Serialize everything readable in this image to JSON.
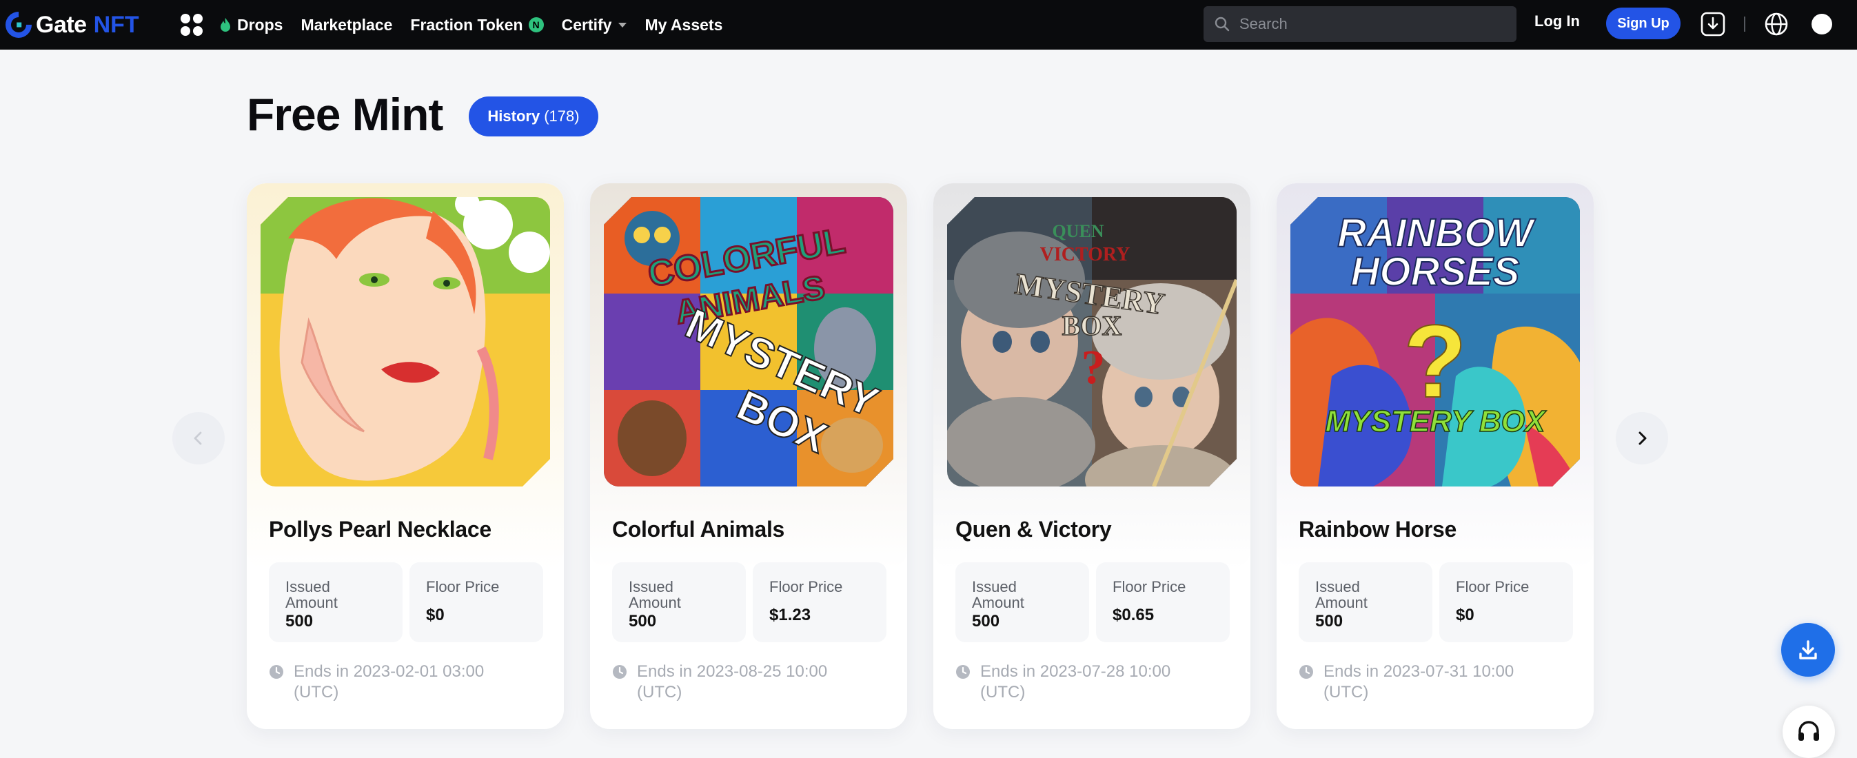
{
  "brand": {
    "name": "Gate",
    "suffix": "NFT"
  },
  "nav": {
    "items": [
      {
        "label": "Drops",
        "icon": "flame-icon"
      },
      {
        "label": "Marketplace"
      },
      {
        "label": "Fraction Token",
        "badge": "N"
      },
      {
        "label": "Certify",
        "dropdown": true
      },
      {
        "label": "My Assets"
      }
    ]
  },
  "search": {
    "placeholder": "Search"
  },
  "auth": {
    "login_label": "Log In",
    "signup_label": "Sign Up"
  },
  "page": {
    "title": "Free Mint",
    "history_label": "History",
    "history_count": "(178)"
  },
  "cards": [
    {
      "title": "Pollys Pearl Necklace",
      "issued_label": "Issued Amount",
      "issued_value": "500",
      "floor_label": "Floor Price",
      "floor_value": "$0",
      "ends_text": "Ends in 2023-02-01 03:00 (UTC)"
    },
    {
      "title": "Colorful Animals",
      "issued_label": "Issued Amount",
      "issued_value": "500",
      "floor_label": "Floor Price",
      "floor_value": "$1.23",
      "ends_text": "Ends in 2023-08-25 10:00 (UTC)",
      "image_text": [
        "COLORFUL",
        "ANIMALS",
        "MYSTERY",
        "BOX"
      ]
    },
    {
      "title": "Quen & Victory",
      "issued_label": "Issued Amount",
      "issued_value": "500",
      "floor_label": "Floor Price",
      "floor_value": "$0.65",
      "ends_text": "Ends in 2023-07-28 10:00 (UTC)",
      "image_text": [
        "QUEN",
        "VICTORY",
        "MYSTERY",
        "BOX"
      ]
    },
    {
      "title": "Rainbow Horse",
      "issued_label": "Issued Amount",
      "issued_value": "500",
      "floor_label": "Floor Price",
      "floor_value": "$0",
      "ends_text": "Ends in 2023-07-31 10:00 (UTC)",
      "image_text": [
        "RAINBOW",
        "HORSES",
        "?",
        "MYSTERY BOX"
      ]
    }
  ],
  "colors": {
    "accent": "#2354e6",
    "nav_bg": "#0a0b0d",
    "page_bg": "#f5f6f8",
    "muted_text": "#a7abb3"
  }
}
